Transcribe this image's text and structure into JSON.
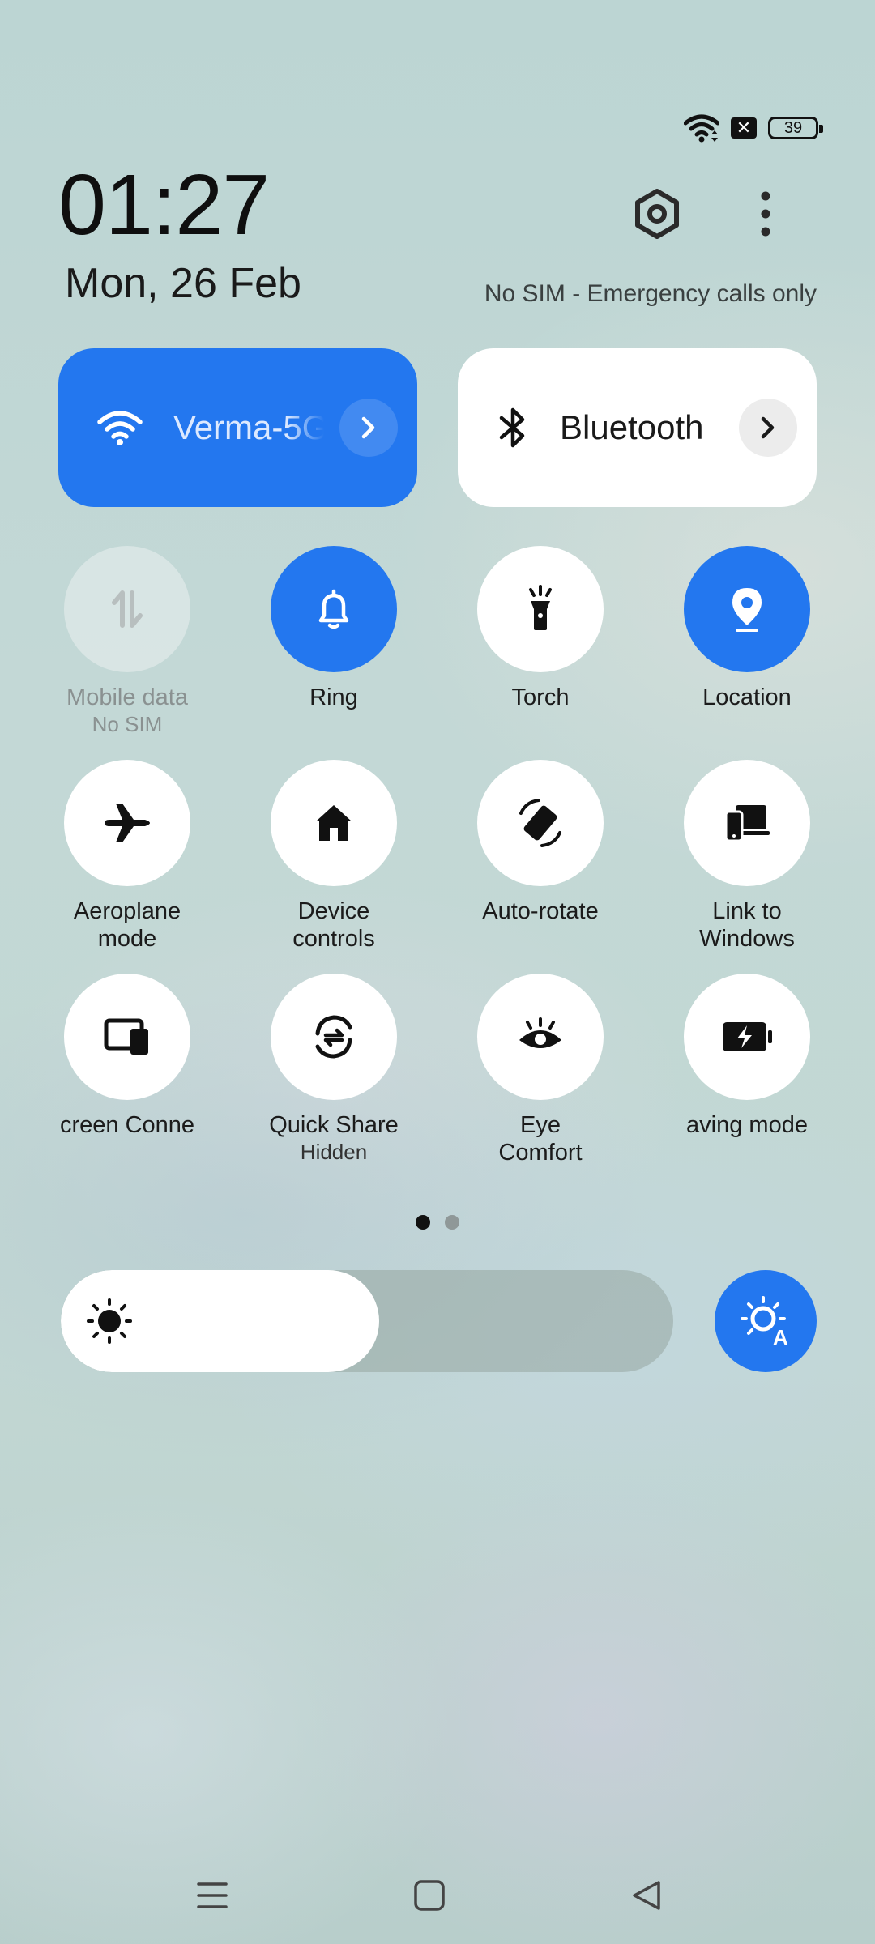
{
  "status": {
    "battery": "39"
  },
  "header": {
    "time": "01:27",
    "date": "Mon, 26 Feb",
    "sim_status": "No SIM - Emergency calls only"
  },
  "wide_tiles": {
    "wifi": {
      "label": "Verma-5G",
      "active": true
    },
    "bluetooth": {
      "label": "Bluetooth",
      "active": false
    }
  },
  "tiles": [
    {
      "id": "mobile-data",
      "label": "Mobile data",
      "sub": "No SIM",
      "icon": "mobile-data-icon",
      "state": "disabled"
    },
    {
      "id": "ring",
      "label": "Ring",
      "sub": "",
      "icon": "bell-icon",
      "state": "on"
    },
    {
      "id": "torch",
      "label": "Torch",
      "sub": "",
      "icon": "torch-icon",
      "state": "off"
    },
    {
      "id": "location",
      "label": "Location",
      "sub": "",
      "icon": "location-pin-icon",
      "state": "on"
    },
    {
      "id": "aeroplane",
      "label": "Aeroplane",
      "label2": "mode",
      "icon": "airplane-icon",
      "state": "off"
    },
    {
      "id": "device-controls",
      "label": "Device",
      "label2": "controls",
      "icon": "home-icon",
      "state": "off"
    },
    {
      "id": "auto-rotate",
      "label": "Auto-rotate",
      "icon": "rotate-icon",
      "state": "off"
    },
    {
      "id": "link-to-windows",
      "label": "Link to",
      "label2": "Windows",
      "icon": "devices-icon",
      "state": "off"
    },
    {
      "id": "screen-connect",
      "label": "creen Conne",
      "icon": "screen-cast-icon",
      "state": "off"
    },
    {
      "id": "quick-share",
      "label": "Quick Share",
      "sub": "Hidden",
      "icon": "quick-share-icon",
      "state": "off"
    },
    {
      "id": "eye-comfort",
      "label": "Eye",
      "label2": "Comfort",
      "icon": "eye-icon",
      "state": "off"
    },
    {
      "id": "power-saving",
      "label": "aving mode",
      "icon": "battery-bolt-icon",
      "state": "off"
    }
  ],
  "pager": {
    "pages": 2,
    "current": 1
  },
  "brightness": {
    "level": 0.52,
    "auto": true
  },
  "colors": {
    "accent": "#2377ef",
    "tile_off": "#ffffff"
  }
}
